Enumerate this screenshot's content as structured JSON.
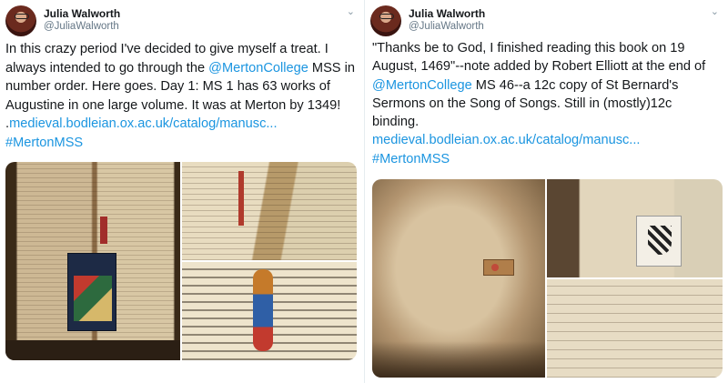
{
  "tweets": [
    {
      "author": "Julia Walworth",
      "handle": "@JuliaWalworth",
      "text": {
        "p1": "In this crazy period I've decided to give myself a treat. I always intended to go through the ",
        "mention": "@MertonCollege",
        "p2": " MSS in number order. Here goes. Day 1: MS 1 has 63 works of Augustine in one large volume. It was at Merton by 1349! .",
        "url": "medieval.bodleian.ox.ac.uk/catalog/manusc...",
        "hashtag": "#MertonMSS"
      },
      "media_count": 3
    },
    {
      "author": "Julia Walworth",
      "handle": "@JuliaWalworth",
      "text": {
        "p1": "\"Thanks be to God, I finished reading this book on 19 August, 1469\"--note added by Robert Elliott at the end of ",
        "mention": "@MertonCollege",
        "p2": " MS 46--a 12c copy of St Bernard's Sermons on the Song of Songs. Still in (mostly)12c binding.",
        "url": "medieval.bodleian.ox.ac.uk/catalog/manusc...",
        "hashtag": "#MertonMSS"
      },
      "media_count": 3
    }
  ],
  "icons": {
    "menu": "chevron-down-icon",
    "avatar": "avatar"
  },
  "colors": {
    "link": "#1b95e0",
    "text": "#14171a",
    "secondary": "#657786"
  }
}
